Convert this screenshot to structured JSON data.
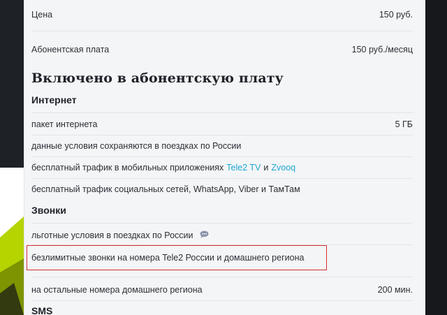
{
  "price": {
    "label": "Цена",
    "value": "150 руб."
  },
  "fee": {
    "label": "Абонентская плата",
    "value": "150 руб./месяц"
  },
  "included_title": "Включено в абонентскую плату",
  "internet": {
    "title": "Интернет",
    "package_label": "пакет интернета",
    "package_value": "5 ГБ",
    "conditions": "данные условия сохраняются в поездках по России",
    "apps_prefix": "бесплатный трафик в мобильных приложениях",
    "app1": "Tele2 TV",
    "and": "и",
    "app2": "Zvooq",
    "social": "бесплатный трафик социальных сетей, WhatsApp, Viber и ТамТам"
  },
  "calls": {
    "title": "Звонки",
    "roaming": "льготные условия в поездках по России",
    "unlimited": "безлимитные звонки на номера Tele2 России и домашнего региона",
    "other_label": "на остальные номера домашнего региона",
    "other_value": "200 мин."
  },
  "sms": {
    "title": "SMS"
  },
  "colors": {
    "link": "#1ea6d6",
    "highlight_border": "#d32f2f",
    "panel_bg": "#f4f5f6",
    "accent_green": "#b5d400"
  },
  "icons": {
    "roaming_info": "chat-bubble-icon"
  }
}
